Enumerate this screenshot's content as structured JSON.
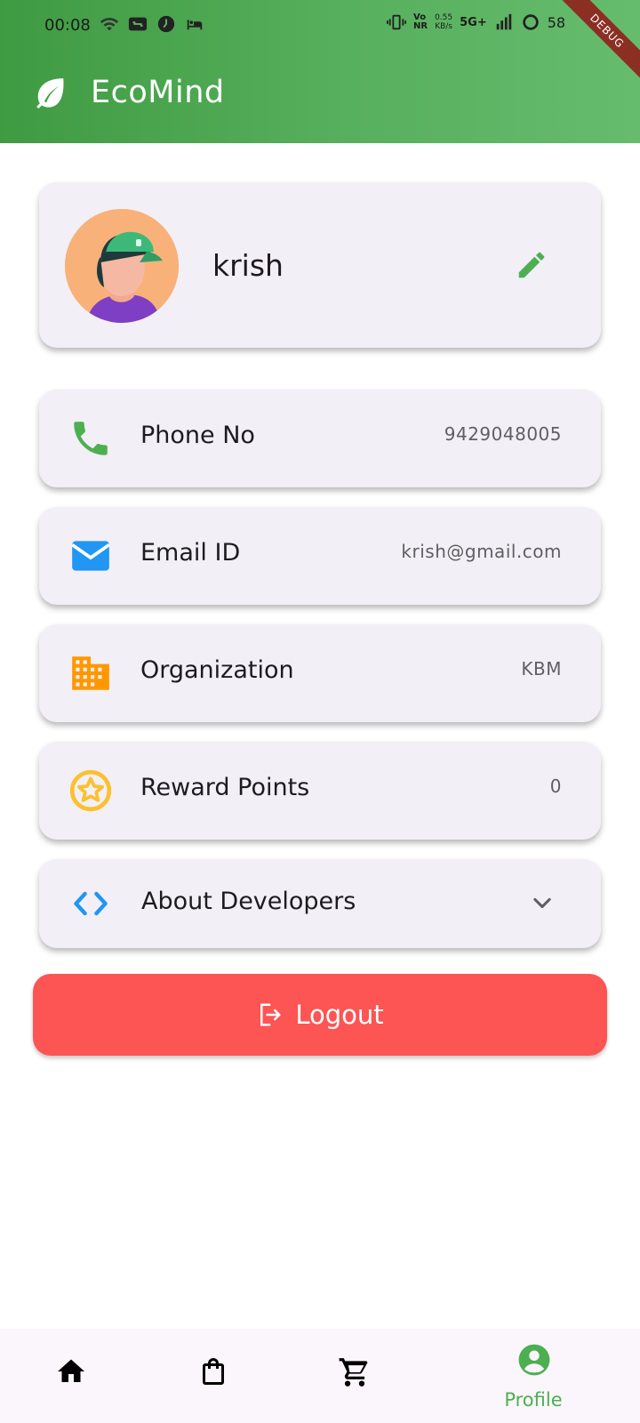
{
  "status_bar": {
    "time": "00:08",
    "network_speed_value": "0.55",
    "network_speed_unit": "KB/s",
    "network_type": "5G+",
    "volte": "Vo",
    "volte_sub": "NR",
    "battery": "58"
  },
  "debug_banner": "DEBUG",
  "app_bar": {
    "title": "EcoMind",
    "logo_icon": "leaf-icon"
  },
  "profile": {
    "name": "krish",
    "edit_icon": "edit-pencil-icon"
  },
  "info_items": [
    {
      "label": "Phone No",
      "value": "9429048005",
      "icon": "phone-icon",
      "color": "#4caf50"
    },
    {
      "label": "Email ID",
      "value": "krish@gmail.com",
      "icon": "email-icon",
      "color": "#2196f3"
    },
    {
      "label": "Organization",
      "value": "KBM",
      "icon": "building-icon",
      "color": "#ff9800"
    },
    {
      "label": "Reward Points",
      "value": "0",
      "icon": "star-medal-icon",
      "color": "#fbc02d"
    }
  ],
  "about": {
    "label": "About Developers",
    "icon": "code-icon",
    "icon_color": "#2196f3",
    "chevron": "chevron-down-icon"
  },
  "logout": {
    "label": "Logout",
    "icon": "logout-icon",
    "color": "#fd5454"
  },
  "bottom_nav": {
    "items": [
      {
        "id": "home",
        "icon": "home-icon",
        "label": ""
      },
      {
        "id": "shop",
        "icon": "shopping-bag-icon",
        "label": ""
      },
      {
        "id": "cart",
        "icon": "cart-icon",
        "label": ""
      },
      {
        "id": "profile",
        "icon": "account-circle-icon",
        "label": "Profile",
        "active": true
      }
    ],
    "active_color": "#4caf50"
  },
  "colors": {
    "header_green": "#4caf50",
    "card_bg": "#f3eff6"
  }
}
